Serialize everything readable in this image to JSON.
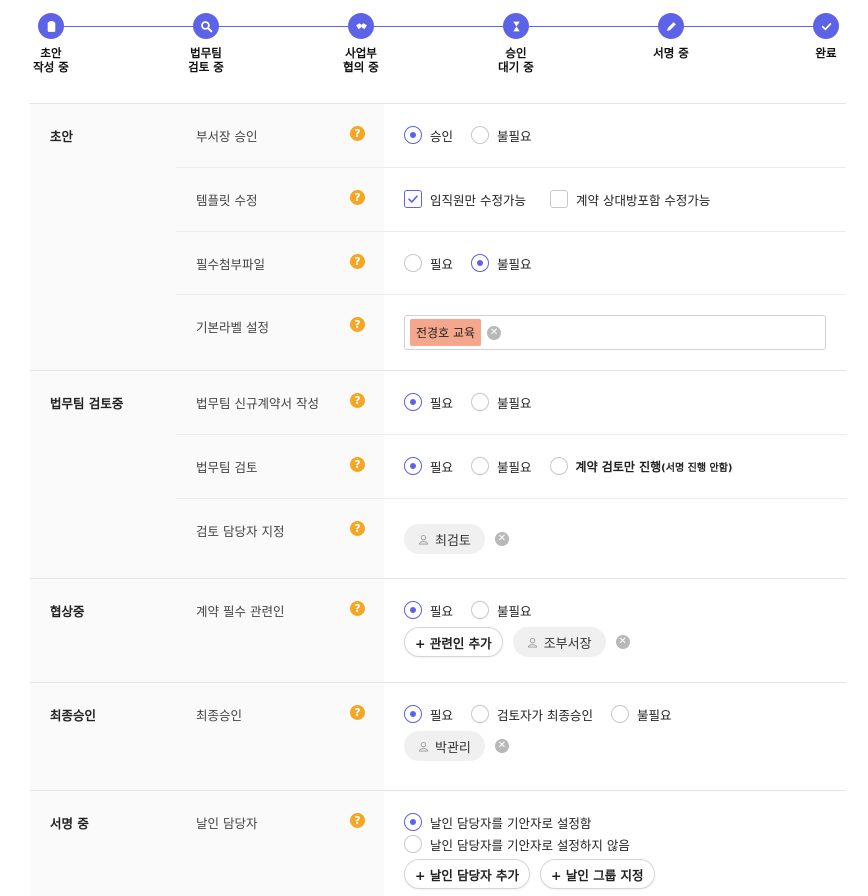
{
  "stepper": {
    "accent": "#5c63e6",
    "steps": [
      {
        "line1": "초안",
        "line2": "작성 중",
        "icon": "clipboard-icon"
      },
      {
        "line1": "법무팀",
        "line2": "검토 중",
        "icon": "search-icon"
      },
      {
        "line1": "사업부",
        "line2": "협의 중",
        "icon": "handshake-icon"
      },
      {
        "line1": "승인",
        "line2": "대기 중",
        "icon": "hourglass-icon"
      },
      {
        "line1": "서명 중",
        "line2": "",
        "icon": "pen-icon"
      },
      {
        "line1": "완료",
        "line2": "",
        "icon": "check-icon"
      }
    ]
  },
  "help_symbol": "?",
  "remove_symbol": "✕",
  "sections": {
    "draft": {
      "title": "초안",
      "dept_approval": {
        "label": "부서장 승인",
        "opt1": "승인",
        "opt2": "불필요",
        "selected": "승인"
      },
      "template_edit": {
        "label": "템플릿 수정",
        "opt1": "임직원만 수정가능",
        "opt2": "계약 상대방포함 수정가능",
        "checked": "임직원만 수정가능"
      },
      "required_files": {
        "label": "필수첨부파일",
        "opt1": "필요",
        "opt2": "불필요",
        "selected": "불필요"
      },
      "default_label": {
        "label": "기본라벨 설정",
        "tag": "전경호 교육",
        "tag_color": "#f4a78d"
      }
    },
    "legal": {
      "title": "법무팀 검토중",
      "new_contract": {
        "label": "법무팀 신규계약서 작성",
        "opt1": "필요",
        "opt2": "불필요",
        "selected": "필요"
      },
      "review": {
        "label": "법무팀 검토",
        "opt1": "필요",
        "opt2": "불필요",
        "opt3": "계약 검토만 진행",
        "opt3_note": "(서명 진행 안함)",
        "selected": "필요"
      },
      "reviewer": {
        "label": "검토 담당자 지정",
        "person": "최검토"
      }
    },
    "negotiation": {
      "title": "협상중",
      "related": {
        "label": "계약 필수 관련인",
        "opt1": "필요",
        "opt2": "불필요",
        "selected": "필요",
        "add_button": "+ 관련인 추가",
        "person": "조부서장"
      }
    },
    "final": {
      "title": "최종승인",
      "approval": {
        "label": "최종승인",
        "opt1": "필요",
        "opt2": "검토자가 최종승인",
        "opt3": "불필요",
        "selected": "필요",
        "person": "박관리"
      }
    },
    "signing": {
      "title": "서명 중",
      "seal": {
        "label": "날인 담당자",
        "opt1": "날인 담당자를 기안자로 설정함",
        "opt2": "날인 담당자를 기안자로 설정하지 않음",
        "selected": "날인 담당자를 기안자로 설정함",
        "add_button": "+ 날인 담당자 추가",
        "group_button": "+ 날인 그룹 지정"
      }
    }
  }
}
